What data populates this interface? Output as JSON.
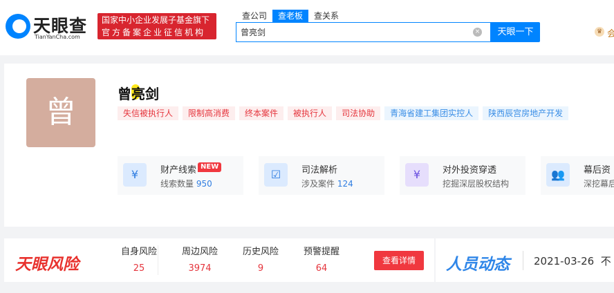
{
  "header": {
    "logo_text": "天眼查",
    "logo_sub": "TianYanCha.com",
    "badge_line1": "国家中小企业发展子基金旗下",
    "badge_line2": "官方备案企业征信机构",
    "tabs": [
      {
        "label": "查公司",
        "active": false
      },
      {
        "label": "查老板",
        "active": true
      },
      {
        "label": "查关系",
        "active": false
      }
    ],
    "search_value": "曾亮剑",
    "search_button": "天眼一下",
    "vip_text": "会"
  },
  "profile": {
    "avatar_char": "曾",
    "name": "曾亮剑",
    "tags": [
      {
        "label": "失信被执行人",
        "type": "risk"
      },
      {
        "label": "限制高消费",
        "type": "risk"
      },
      {
        "label": "终本案件",
        "type": "risk"
      },
      {
        "label": "被执行人",
        "type": "risk"
      },
      {
        "label": "司法协助",
        "type": "risk"
      },
      {
        "label": "青海省建工集团实控人",
        "type": "info"
      },
      {
        "label": "陕西辰宫房地产开发",
        "type": "info"
      }
    ],
    "features": [
      {
        "title": "财产线索",
        "badge": "NEW",
        "sub": "线索数量",
        "count": "950",
        "icon": "property-clue-icon"
      },
      {
        "title": "司法解析",
        "sub": "涉及案件",
        "count": "124",
        "icon": "judicial-analysis-icon"
      },
      {
        "title": "对外投资穿透",
        "sub": "挖掘深层股权结构",
        "icon": "investment-icon"
      },
      {
        "title": "幕后资",
        "sub": "深挖幕后",
        "icon": "behind-scenes-icon"
      }
    ]
  },
  "risk": {
    "logo": "天眼风险",
    "items": [
      {
        "label": "自身风险",
        "value": "25"
      },
      {
        "label": "周边风险",
        "value": "3974"
      },
      {
        "label": "历史风险",
        "value": "9"
      },
      {
        "label": "预警提醒",
        "value": "64"
      }
    ],
    "detail_button": "查看详情"
  },
  "dynamics": {
    "logo": "人员动态",
    "date": "2021-03-26",
    "text": "不"
  },
  "colors": {
    "brand_blue": "#0084ff",
    "risk_red": "#e5353d"
  }
}
